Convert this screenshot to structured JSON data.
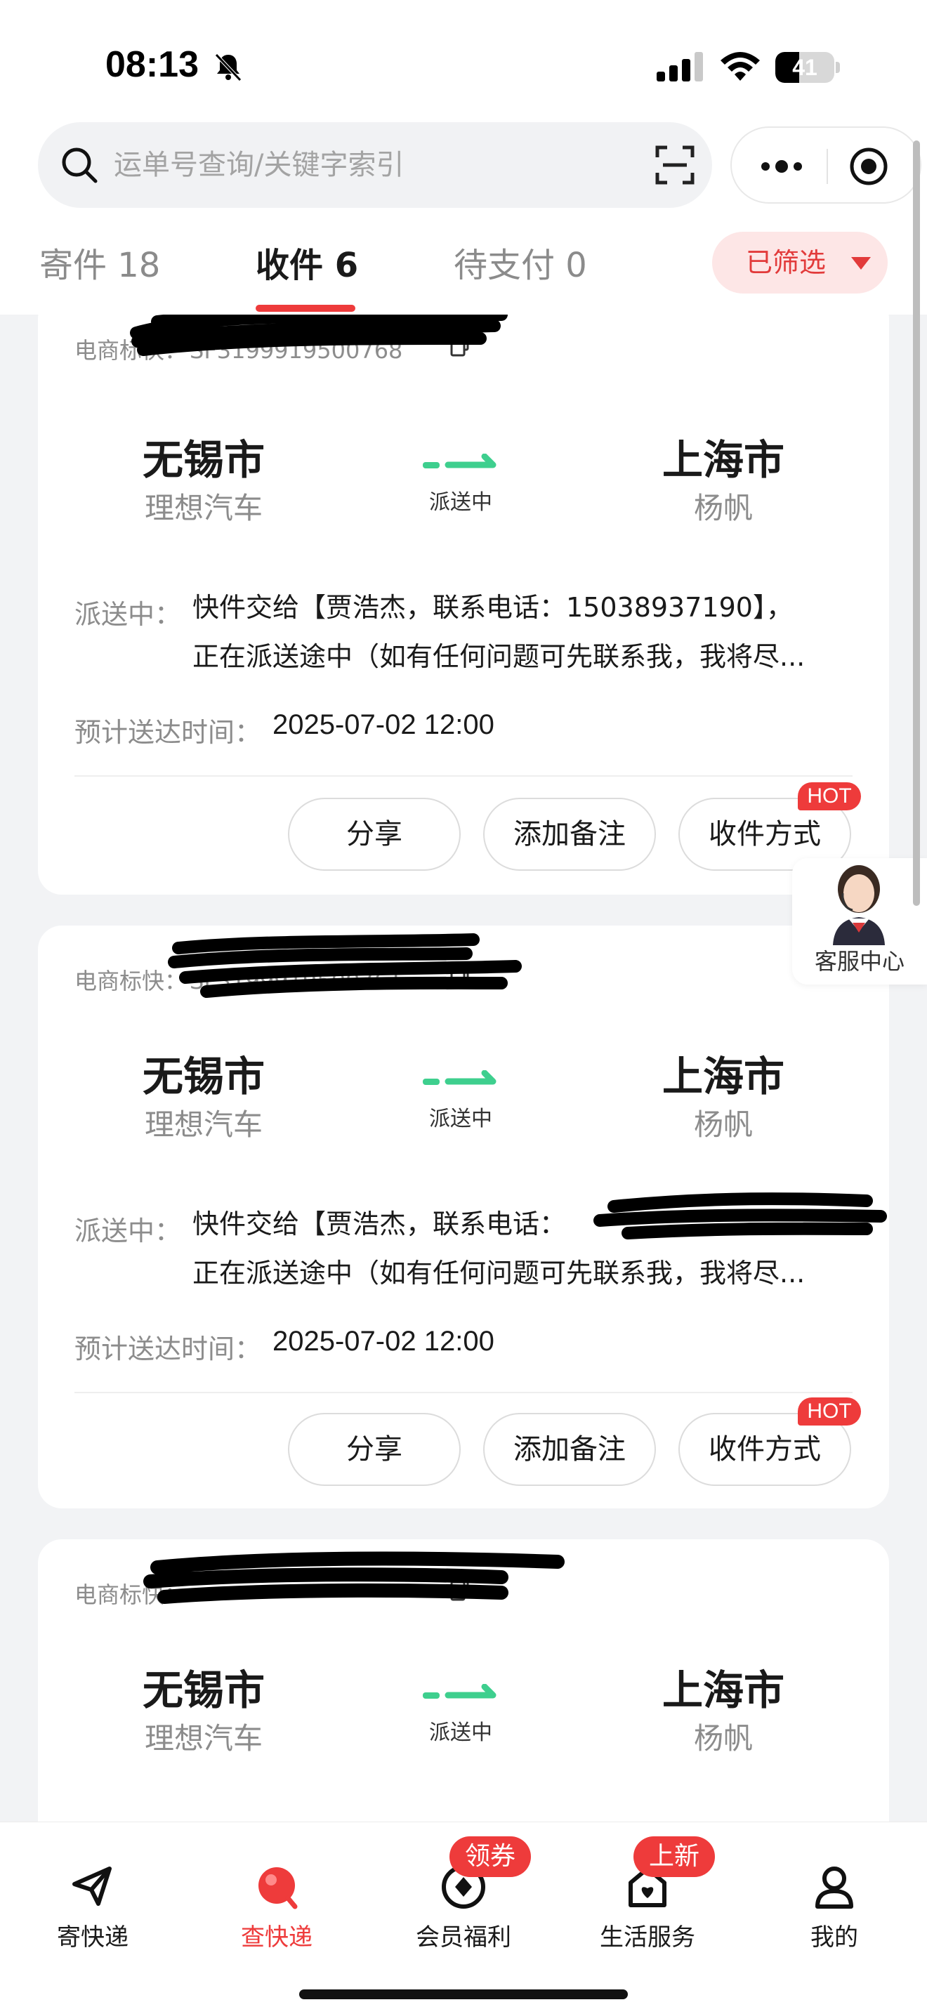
{
  "status_bar": {
    "time": "08:13",
    "battery": "41",
    "battery_level": 0.41
  },
  "search": {
    "placeholder": "运单号查询/关键字索引"
  },
  "tabs": [
    {
      "label": "寄件 18",
      "active": false
    },
    {
      "label": "收件 6",
      "active": true
    },
    {
      "label": "待支付 0",
      "active": false
    }
  ],
  "filter_label": "已筛选",
  "cards": [
    {
      "tracking_label": "电商标快：",
      "tracking_number": "SF3199919500768",
      "origin_city": "无锡市",
      "origin_name": "理想汽车",
      "status": "派送中",
      "dest_city": "上海市",
      "dest_name": "杨帆",
      "detail_label": "派送中：",
      "detail_line1": "快件交给【贾浩杰，联系电话：15038937190】，",
      "detail_line2": "正在派送途中（如有任何问题可先联系我，我将尽...",
      "eta_label": "预计送达时间：",
      "eta_value": "2025-07-02 12:00",
      "actions": [
        "分享",
        "添加备注",
        "收件方式"
      ],
      "hot_badge": "HOT"
    },
    {
      "tracking_label": "电商标快：",
      "tracking_number": "SF3199919500761",
      "origin_city": "无锡市",
      "origin_name": "理想汽车",
      "status": "派送中",
      "dest_city": "上海市",
      "dest_name": "杨帆",
      "detail_label": "派送中：",
      "detail_line1": "快件交给【贾浩杰，联系电话：",
      "detail_line2": "正在派送途中（如有任何问题可先联系我，我将尽...",
      "eta_label": "预计送达时间：",
      "eta_value": "2025-07-02 12:00",
      "actions": [
        "分享",
        "添加备注",
        "收件方式"
      ],
      "hot_badge": "HOT"
    },
    {
      "tracking_label": "电商标快：",
      "tracking_number": "",
      "origin_city": "无锡市",
      "origin_name": "理想汽车",
      "status": "派送中",
      "dest_city": "上海市",
      "dest_name": "杨帆"
    }
  ],
  "customer_service": {
    "label": "客服中心"
  },
  "bottom_nav": [
    {
      "label": "寄快递",
      "icon": "send-plane-icon",
      "active": false
    },
    {
      "label": "查快递",
      "icon": "track-icon",
      "active": true
    },
    {
      "label": "会员福利",
      "icon": "member-icon",
      "active": false,
      "badge": "领券"
    },
    {
      "label": "生活服务",
      "icon": "life-service-icon",
      "active": false,
      "badge": "上新"
    },
    {
      "label": "我的",
      "icon": "profile-icon",
      "active": false
    }
  ],
  "colors": {
    "accent": "#ee3b3b",
    "route_green": "#3ecf8e",
    "badge_bg": "#fde6e6"
  }
}
